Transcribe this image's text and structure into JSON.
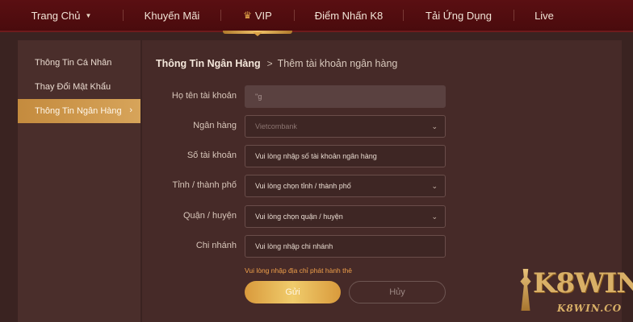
{
  "nav": {
    "items": [
      {
        "label": "Trang Chủ"
      },
      {
        "label": "Khuyến Mãi"
      },
      {
        "label": "VIP"
      },
      {
        "label": "Điểm Nhấn K8"
      },
      {
        "label": "Tải Ứng Dụng"
      },
      {
        "label": "Live"
      }
    ]
  },
  "sidebar": {
    "items": [
      {
        "label": "Thông Tin Cá Nhân"
      },
      {
        "label": "Thay Đổi Mật Khẩu"
      },
      {
        "label": "Thông Tin Ngân Hàng"
      }
    ]
  },
  "breadcrumb": {
    "section": "Thông Tin Ngân Hàng",
    "separator": ">",
    "current": "Thêm tài khoản ngân hàng"
  },
  "form": {
    "holder_name": {
      "label": "Họ tên tài khoản",
      "value": "''g"
    },
    "bank": {
      "label": "Ngân hàng",
      "value": "Vietcombank"
    },
    "account_number": {
      "label": "Số tài khoản",
      "placeholder": "Vui lòng nhập số tài khoản ngân hàng"
    },
    "province": {
      "label": "Tỉnh / thành phố",
      "value": "Vui lòng chọn tỉnh / thành phố"
    },
    "district": {
      "label": "Quận / huyện",
      "value": "Vui lòng chọn quận / huyện"
    },
    "branch": {
      "label": "Chi nhánh",
      "placeholder": "Vui lòng nhập chi nhánh"
    },
    "hint": "Vui lòng nhập địa chỉ phát hành thẻ",
    "submit_label": "Gửi",
    "cancel_label": "Hủy"
  },
  "watermark": {
    "brand": "K8WIN",
    "site": "K8WIN.CO"
  },
  "colors": {
    "accent_gold": "#e0ac50",
    "nav_bg": "#520d10",
    "hint_orange": "#f0a04a"
  }
}
